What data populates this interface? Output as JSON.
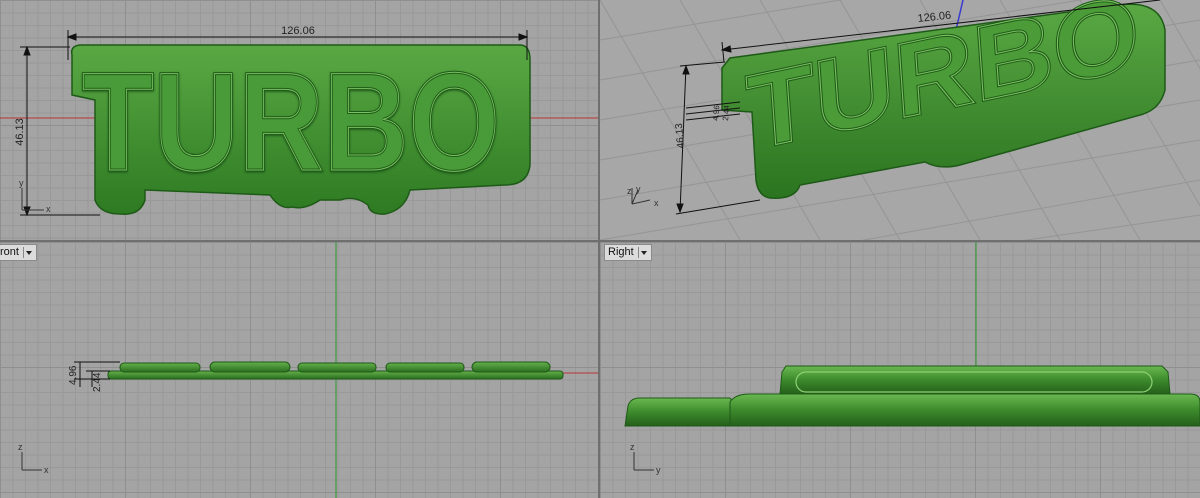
{
  "viewports": {
    "top": {
      "label": ""
    },
    "perspective": {
      "label": ""
    },
    "front": {
      "label": "ront"
    },
    "right": {
      "label": "Right"
    }
  },
  "model": {
    "text": "TURBO",
    "color": "#3f8f2d"
  },
  "dimensions": {
    "top": {
      "width": "126.06",
      "height": "46.13"
    },
    "perspective": {
      "width": "126.06",
      "height": "46.13",
      "small_a": "4.96",
      "small_b": "2.44"
    },
    "front": {
      "total": "4.96",
      "base": "2.44"
    }
  },
  "axes": {
    "top": {
      "x": "x",
      "y": "y"
    },
    "perspective": {
      "x": "x",
      "y": "y",
      "z": "z"
    },
    "front": {
      "x": "x",
      "z": "z"
    },
    "right": {
      "y": "y",
      "z": "z"
    }
  }
}
